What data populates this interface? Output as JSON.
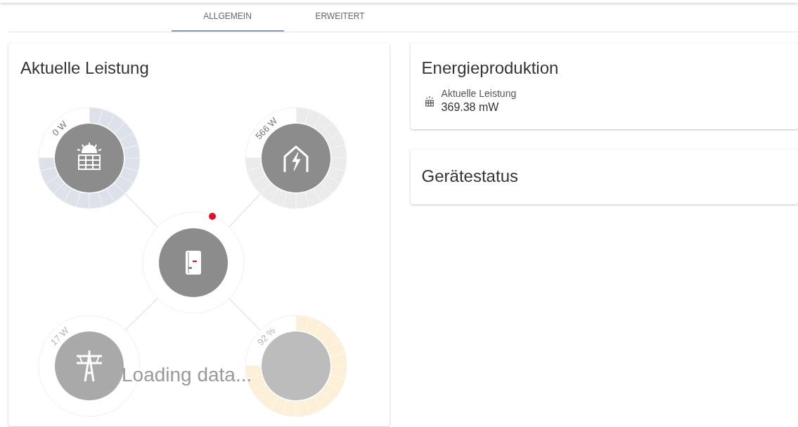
{
  "tabs": [
    {
      "label": "ALLGEMEIN",
      "selected": true
    },
    {
      "label": "ERWEITERT",
      "selected": false
    }
  ],
  "power_card": {
    "title": "Aktuelle Leistung",
    "nodes": [
      {
        "kind": "solar",
        "reading": "0 W",
        "color": "#dde2ea",
        "faded": false
      },
      {
        "kind": "house",
        "reading": "566 W",
        "color": "#ebebeb",
        "faded": false
      },
      {
        "kind": "inverter",
        "alert": true,
        "faded": false
      },
      {
        "kind": "grid",
        "reading": "17 W",
        "faded": true
      },
      {
        "kind": "battery",
        "reading": "92 %",
        "color": "#fdf0d8",
        "faded": true
      }
    ],
    "loading": "Loading data..."
  },
  "energy_card": {
    "title": "Energieproduktion",
    "items": [
      {
        "label": "Aktuelle Leistung",
        "value": "369.38 mW"
      }
    ]
  },
  "status_card": {
    "title": "Gerätestatus"
  }
}
